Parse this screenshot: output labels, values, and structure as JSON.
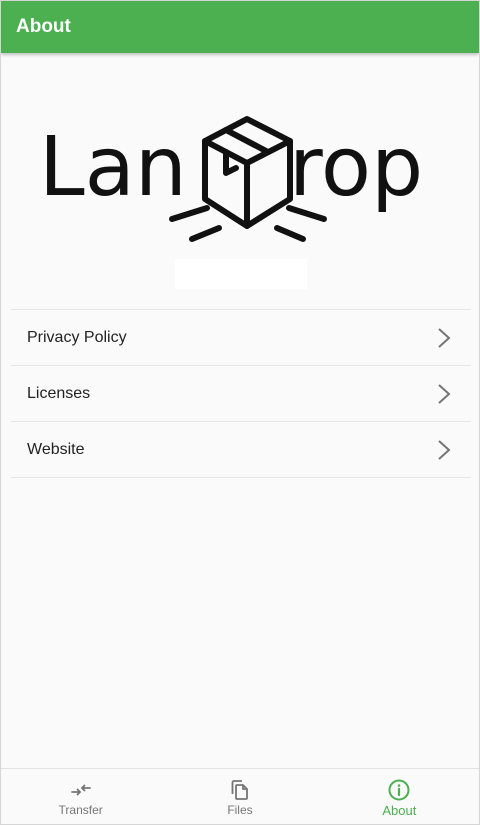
{
  "appbar": {
    "title": "About"
  },
  "logo": {
    "text_left": "Lan",
    "text_right": "rop"
  },
  "version": {
    "text": ""
  },
  "menu": {
    "items": [
      {
        "label": "Privacy Policy"
      },
      {
        "label": "Licenses"
      },
      {
        "label": "Website"
      }
    ]
  },
  "bottom_nav": {
    "items": [
      {
        "label": "Transfer",
        "icon": "transfer-icon",
        "active": false
      },
      {
        "label": "Files",
        "icon": "files-icon",
        "active": false
      },
      {
        "label": "About",
        "icon": "info-icon",
        "active": true
      }
    ]
  },
  "colors": {
    "primary": "#4caf50",
    "inactive": "#757575",
    "chevron": "#757575",
    "logo": "#111111"
  }
}
